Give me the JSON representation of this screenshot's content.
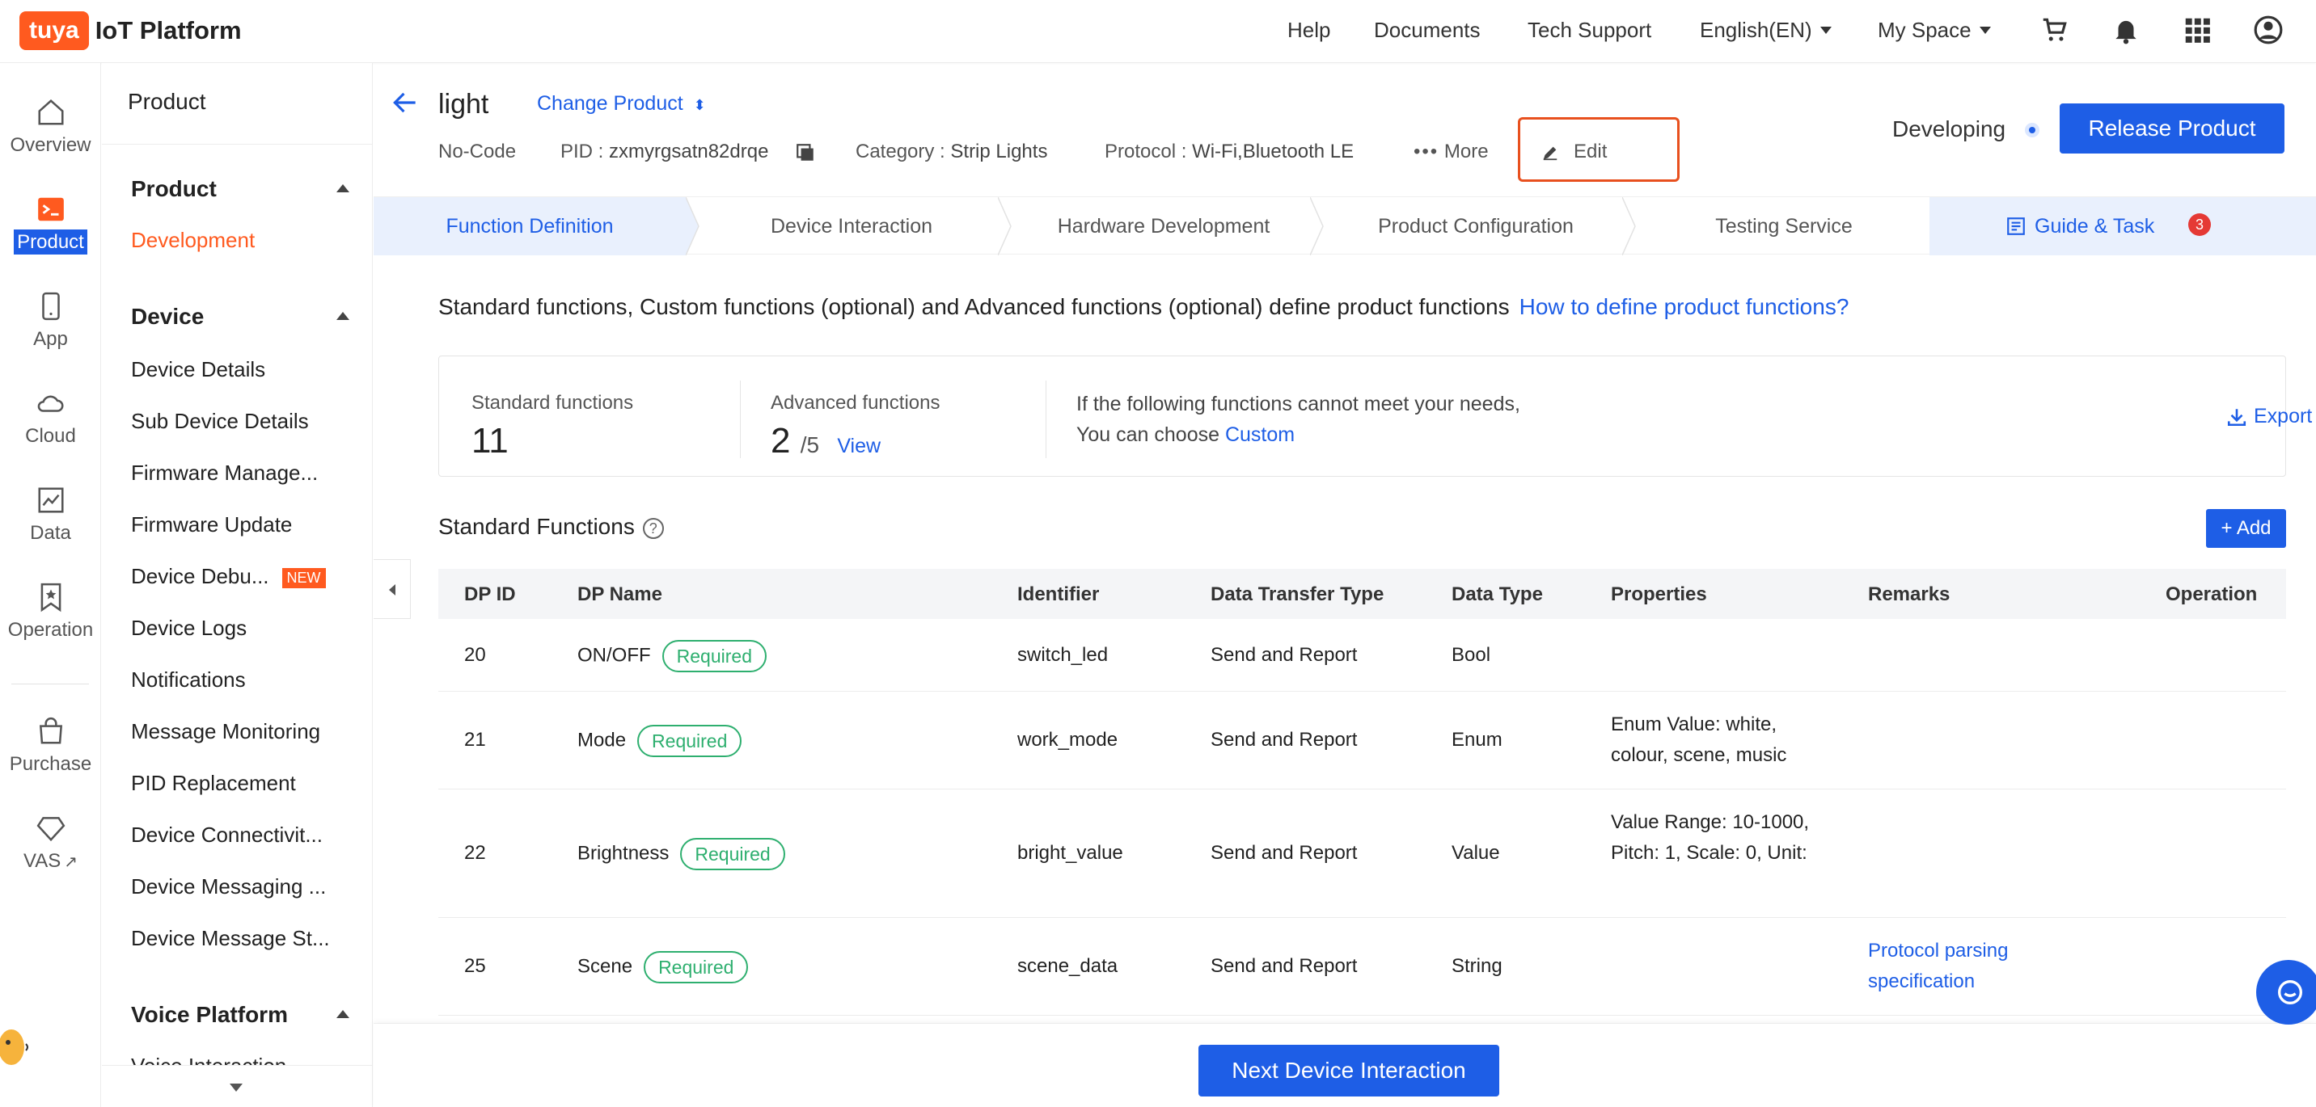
{
  "brand": {
    "logo_text": "tuya",
    "platform_name": "IoT Platform",
    "accent": "#1e5ee6",
    "brand_orange": "#ff5a1f"
  },
  "topnav": {
    "help": "Help",
    "documents": "Documents",
    "tech_support": "Tech Support",
    "language": "English(EN)",
    "space": "My Space"
  },
  "rail": {
    "overview": "Overview",
    "product": "Product",
    "app": "App",
    "cloud": "Cloud",
    "data": "Data",
    "operation": "Operation",
    "purchase": "Purchase",
    "vas": "VAS"
  },
  "sidenav": {
    "header": "Product",
    "product_section": "Product",
    "development": "Development",
    "device_section": "Device",
    "items": [
      "Device Details",
      "Sub Device Details",
      "Firmware Manage...",
      "Firmware Update",
      "Device Debu...",
      "Device Logs",
      "Notifications",
      "Message Monitoring",
      "PID Replacement",
      "Device Connectivit...",
      "Device Messaging ...",
      "Device Message St..."
    ],
    "new_badge": "NEW",
    "voice_section": "Voice Platform",
    "voice_partial": "Voice Interaction"
  },
  "product": {
    "name": "light",
    "change_label": "Change Product",
    "mode": "No-Code",
    "pid_label": "PID :",
    "pid": "zxmyrgsatn82drqe",
    "category_label": "Category :",
    "category": "Strip Lights",
    "protocol_label": "Protocol :",
    "protocol": "Wi-Fi,Bluetooth LE",
    "more": "More",
    "edit": "Edit",
    "status": "Developing",
    "release": "Release Product"
  },
  "steps": [
    "Function Definition",
    "Device Interaction",
    "Hardware Development",
    "Product Configuration",
    "Testing Service"
  ],
  "guide": {
    "label": "Guide & Task",
    "count": "3"
  },
  "intro": {
    "text": "Standard functions, Custom functions (optional) and Advanced functions (optional) define product functions",
    "link": "How to define product functions?"
  },
  "summary": {
    "standard_label": "Standard functions",
    "standard_count": "11",
    "advanced_label": "Advanced functions",
    "advanced_count": "2",
    "advanced_max": "/5",
    "view": "View",
    "info_line1": "If the following functions cannot meet your needs,",
    "info_line2": "You can choose",
    "custom": "Custom",
    "export": "Export"
  },
  "standard_functions": {
    "title": "Standard Functions",
    "add": "+ Add",
    "headers": [
      "DP ID",
      "DP Name",
      "Identifier",
      "Data Transfer Type",
      "Data Type",
      "Properties",
      "Remarks",
      "Operation"
    ],
    "rows": [
      {
        "id": "20",
        "name": "ON/OFF",
        "tag": "Required",
        "identifier": "switch_led",
        "transfer": "Send and Report",
        "type": "Bool",
        "props": "",
        "remarks": ""
      },
      {
        "id": "21",
        "name": "Mode",
        "tag": "Required",
        "identifier": "work_mode",
        "transfer": "Send and Report",
        "type": "Enum",
        "props": "Enum Value: white, colour, scene, music",
        "remarks": ""
      },
      {
        "id": "22",
        "name": "Brightness",
        "tag": "Required",
        "identifier": "bright_value",
        "transfer": "Send and Report",
        "type": "Value",
        "props": "Value Range: 10-1000, Pitch: 1, Scale: 0, Unit:",
        "remarks": ""
      },
      {
        "id": "25",
        "name": "Scene",
        "tag": "Required",
        "identifier": "scene_data",
        "transfer": "Send and Report",
        "type": "String",
        "props": "",
        "remarks": "Protocol parsing specification"
      }
    ]
  },
  "footer": {
    "next": "Next Device Interaction"
  }
}
